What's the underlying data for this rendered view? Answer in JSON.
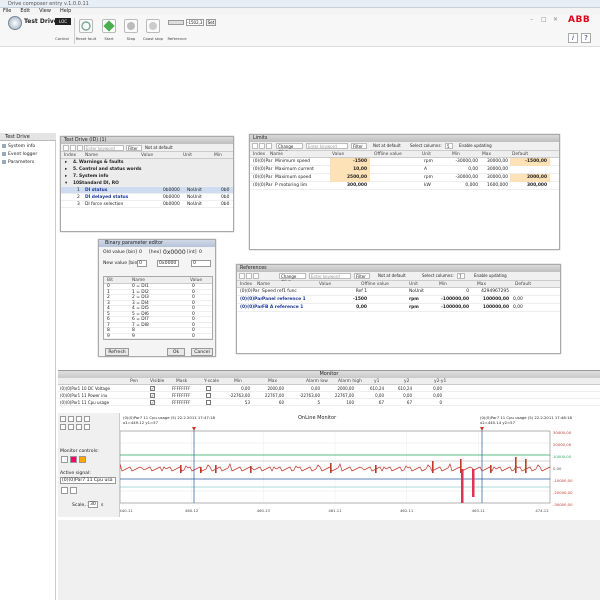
{
  "window": {
    "title": "Drive composer entry v.1.0.0.11"
  },
  "menu": [
    "File",
    "Edit",
    "View",
    "Help"
  ],
  "toolbar": {
    "title": "Test Drive",
    "loc_badge": "LOC",
    "labels": [
      "Control",
      "Reset fault",
      "Start",
      "Stop",
      "Coast stop",
      "Reference"
    ],
    "reference_value": "-1502,3",
    "set_label": "Set",
    "brand": "ABB"
  },
  "sidebar": {
    "tab": "Test Drive",
    "items": [
      "System info",
      "Event logger",
      "Parameters"
    ]
  },
  "params_panel": {
    "title": "Test Drive (ID) (1)",
    "search_placeholder": "Enter keyword",
    "filter": "Filter",
    "not_default": "Not at default",
    "columns": [
      "Index",
      "Name",
      "Value",
      "Unit",
      "Min"
    ],
    "groups": [
      {
        "index": "4.",
        "name": "Warnings & faults"
      },
      {
        "index": "5.",
        "name": "Control and status words"
      },
      {
        "index": "7.",
        "name": "System info"
      },
      {
        "index": "10.",
        "name": "Standard DI, RO"
      }
    ],
    "rows": [
      {
        "index": "1",
        "name": "DI status",
        "value": "0b0000",
        "unit": "NoUnit",
        "min": "0b0"
      },
      {
        "index": "2",
        "name": "DI delayed status",
        "value": "0b0000",
        "unit": "NoUnit",
        "min": "0b0"
      },
      {
        "index": "3",
        "name": "DI force selection",
        "value": "0b0000",
        "unit": "NoUnit",
        "min": "0b0"
      }
    ]
  },
  "binary_editor": {
    "title": "Binary parameter editor",
    "old_value_label": "Old value [bin]",
    "old_value": "0",
    "hex_label": "[hex]",
    "hex_value": "0x0000",
    "int_label": "[int]",
    "int_value": "0",
    "new_value_label": "New value [bin]",
    "new_value": "0",
    "new_hex": "0x0000",
    "new_int": "0",
    "columns": [
      "Bit",
      "Name",
      "Value"
    ],
    "bits": [
      {
        "bit": "0",
        "name": "0 = DI1",
        "value": "0"
      },
      {
        "bit": "1",
        "name": "1 = DI2",
        "value": "0"
      },
      {
        "bit": "2",
        "name": "2 = DI3",
        "value": "0"
      },
      {
        "bit": "3",
        "name": "3 = DI4",
        "value": "0"
      },
      {
        "bit": "4",
        "name": "4 = DI5",
        "value": "0"
      },
      {
        "bit": "5",
        "name": "5 = DI6",
        "value": "0"
      },
      {
        "bit": "6",
        "name": "6 = DI7",
        "value": "0"
      },
      {
        "bit": "7",
        "name": "7 = DI8",
        "value": "0"
      },
      {
        "bit": "8",
        "name": "8",
        "value": "0"
      },
      {
        "bit": "9",
        "name": "9",
        "value": "0"
      }
    ],
    "refresh": "Refresh",
    "ok": "Ok",
    "cancel": "Cancel"
  },
  "limits_panel": {
    "title": "Limits",
    "change_drive": "Change drive",
    "search_placeholder": "Enter keyword",
    "filter": "Filter",
    "not_default": "Not at default",
    "select_columns": "Select columns:",
    "columns_value": "5",
    "enable_updating": "Enable updating",
    "columns": [
      "Index",
      "Name",
      "Value",
      "Offline value",
      "Unit",
      "Min",
      "Max",
      "Default"
    ],
    "rows": [
      {
        "index": "(0)(0)Par",
        "name": "Minimum speed",
        "value": "-1500",
        "offline": "",
        "unit": "rpm",
        "min": "-30000,00",
        "max": "30000,00",
        "def": "-1500,00",
        "hl": true
      },
      {
        "index": "(0)(0)Par",
        "name": "Maximum current",
        "value": "10,00",
        "offline": "",
        "unit": "A",
        "min": "0,00",
        "max": "30000,00",
        "def": "",
        "hl": true
      },
      {
        "index": "(0)(0)Par",
        "name": "Maximum speed",
        "value": "2500,00",
        "offline": "",
        "unit": "rpm",
        "min": "-30000,00",
        "max": "30000,00",
        "def": "2000,00",
        "hl": true
      },
      {
        "index": "(0)(0)Par",
        "name": "P motoring lim",
        "value": "300,000",
        "offline": "",
        "unit": "kW",
        "min": "0,000",
        "max": "1600,000",
        "def": "300,000",
        "hl": false
      }
    ]
  },
  "references_panel": {
    "title": "References",
    "change_drive": "Change drive",
    "search_placeholder": "Enter keyword",
    "filter": "Filter",
    "not_default": "Not at default",
    "select_columns": "Select columns:",
    "columns_value": "7",
    "enable_updating": "Enable updating",
    "columns": [
      "Index",
      "Name",
      "Value",
      "Offline value",
      "Unit",
      "Min",
      "Max",
      "Default"
    ],
    "rows": [
      {
        "index": "(0)(0)Par",
        "name": "Speed ref1 func",
        "value": "",
        "offline": "Ref 1",
        "unit": "NoUnit",
        "min": "0",
        "max": "4294967295",
        "def": ""
      },
      {
        "index": "(0)(0)Par",
        "name": "Panel reference 1",
        "value": "",
        "offline": "-1500",
        "unit": "rpm",
        "min": "-100000,00",
        "max": "100000,00",
        "def": "0,00"
      },
      {
        "index": "(0)(0)Par",
        "name": "FB A reference 1",
        "value": "",
        "offline": "0,00",
        "unit": "rpm",
        "min": "-100000,00",
        "max": "100000,00",
        "def": "0,00"
      }
    ]
  },
  "monitor": {
    "title": "Monitor",
    "columns": [
      "",
      "Pen",
      "Visible",
      "Mask",
      "Y-scale",
      "Min",
      "Max",
      "Alarm low",
      "Alarm high",
      "y1",
      "y2",
      "y2-y1"
    ],
    "rows": [
      {
        "name": "(0)(0)Par1 10 DC Voltage",
        "mask": "FFFFFFFF",
        "min": "0,00",
        "max": "2000,00",
        "alow": "0,00",
        "ahigh": "2000,00",
        "y1": "610,24",
        "y2": "610,24",
        "d": "0,00"
      },
      {
        "name": "(0)(0)Par1 11 Power inu",
        "mask": "FFFFFFFF",
        "min": "-22763,00",
        "max": "22767,00",
        "alow": "-22763,00",
        "ahigh": "22767,00",
        "y1": "0,00",
        "y2": "0,00",
        "d": "0,00"
      },
      {
        "name": "(0)(0)Par1 11 Cpu usage",
        "mask": "FFFFFFFF",
        "min": "53",
        "max": "60",
        "alow": "5",
        "ahigh": "100",
        "y1": "67",
        "y2": "67",
        "d": "0"
      }
    ],
    "chart_title": "OnLine Monitor",
    "cursor1": "(0)(0)Par7 11 Cpu usage (5) 22.2.2011 17:47:18",
    "cursor1b": "x1=449.12 y1=57",
    "cursor2": "(0)(0)Par7 11 Cpu usage (5) 22.2.2011 17:48:18",
    "cursor2b": "x2=440.14 y2=57",
    "controls_label": "Monitor controls:",
    "active_signal_label": "Active signal:",
    "active_signal": "(0)(0)Par7 11 Cpu usa",
    "scale_label": "Scale, X",
    "scale_value": "30",
    "scale_unit": "s",
    "x_ticks": [
      "440.11",
      "460.12",
      "460.13",
      "461.11",
      "462.11",
      "463.11",
      "474.12"
    ],
    "y_right": [
      "30000,00",
      "20000,00",
      "10000,00",
      "0,00",
      "-10000,00",
      "-20000,00",
      "-30000,00"
    ],
    "colors": {
      "dc": "#c0392b",
      "power": "#27ae60",
      "cpu": "#2c5aa0"
    }
  }
}
